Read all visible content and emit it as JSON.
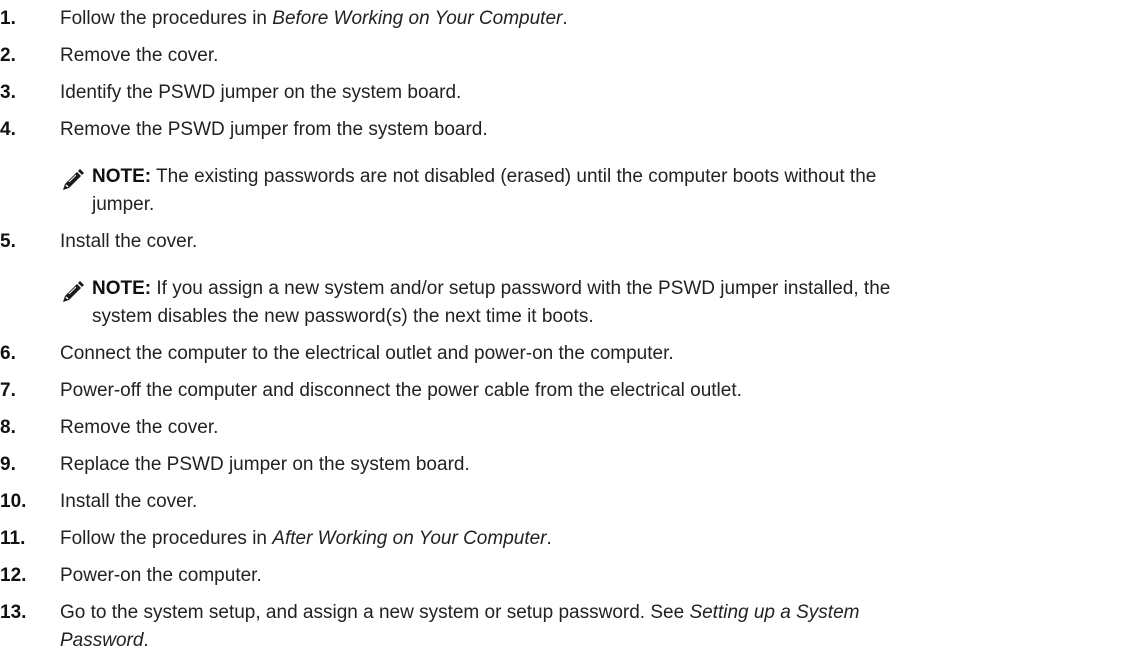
{
  "steps": [
    {
      "num": "1.",
      "pre": "Follow the procedures in ",
      "ref": "Before Working on Your Computer",
      "post": "."
    },
    {
      "num": "2.",
      "text": "Remove the cover."
    },
    {
      "num": "3.",
      "text": "Identify the PSWD jumper on the system board."
    },
    {
      "num": "4.",
      "text": "Remove the PSWD jumper from the system board."
    },
    {
      "num": "5.",
      "text": "Install the cover."
    },
    {
      "num": "6.",
      "text": "Connect the computer to the electrical outlet and power-on the computer."
    },
    {
      "num": "7.",
      "text": "Power-off the computer and disconnect the power cable from the electrical outlet."
    },
    {
      "num": "8.",
      "text": "Remove the cover."
    },
    {
      "num": "9.",
      "text": "Replace the PSWD jumper on the system board."
    },
    {
      "num": "10.",
      "text": "Install the cover."
    },
    {
      "num": "11.",
      "pre": "Follow the procedures in ",
      "ref": "After Working on Your Computer",
      "post": "."
    },
    {
      "num": "12.",
      "text": "Power-on the computer."
    },
    {
      "num": "13.",
      "pre": "Go to the system setup, and assign a new system or setup password. See ",
      "ref_line1": "Setting up a System",
      "ref_line2": "Password",
      "post": "."
    }
  ],
  "notes": [
    {
      "label": "NOTE:",
      "line1": " The existing passwords are not disabled (erased) until the computer boots without the",
      "line2": "jumper."
    },
    {
      "label": "NOTE:",
      "line1": " If you assign a new system and/or setup password with the PSWD jumper installed, the",
      "line2": "system disables the new password(s) the next time it boots."
    }
  ],
  "icons": {
    "note": "pencil-note-icon"
  }
}
